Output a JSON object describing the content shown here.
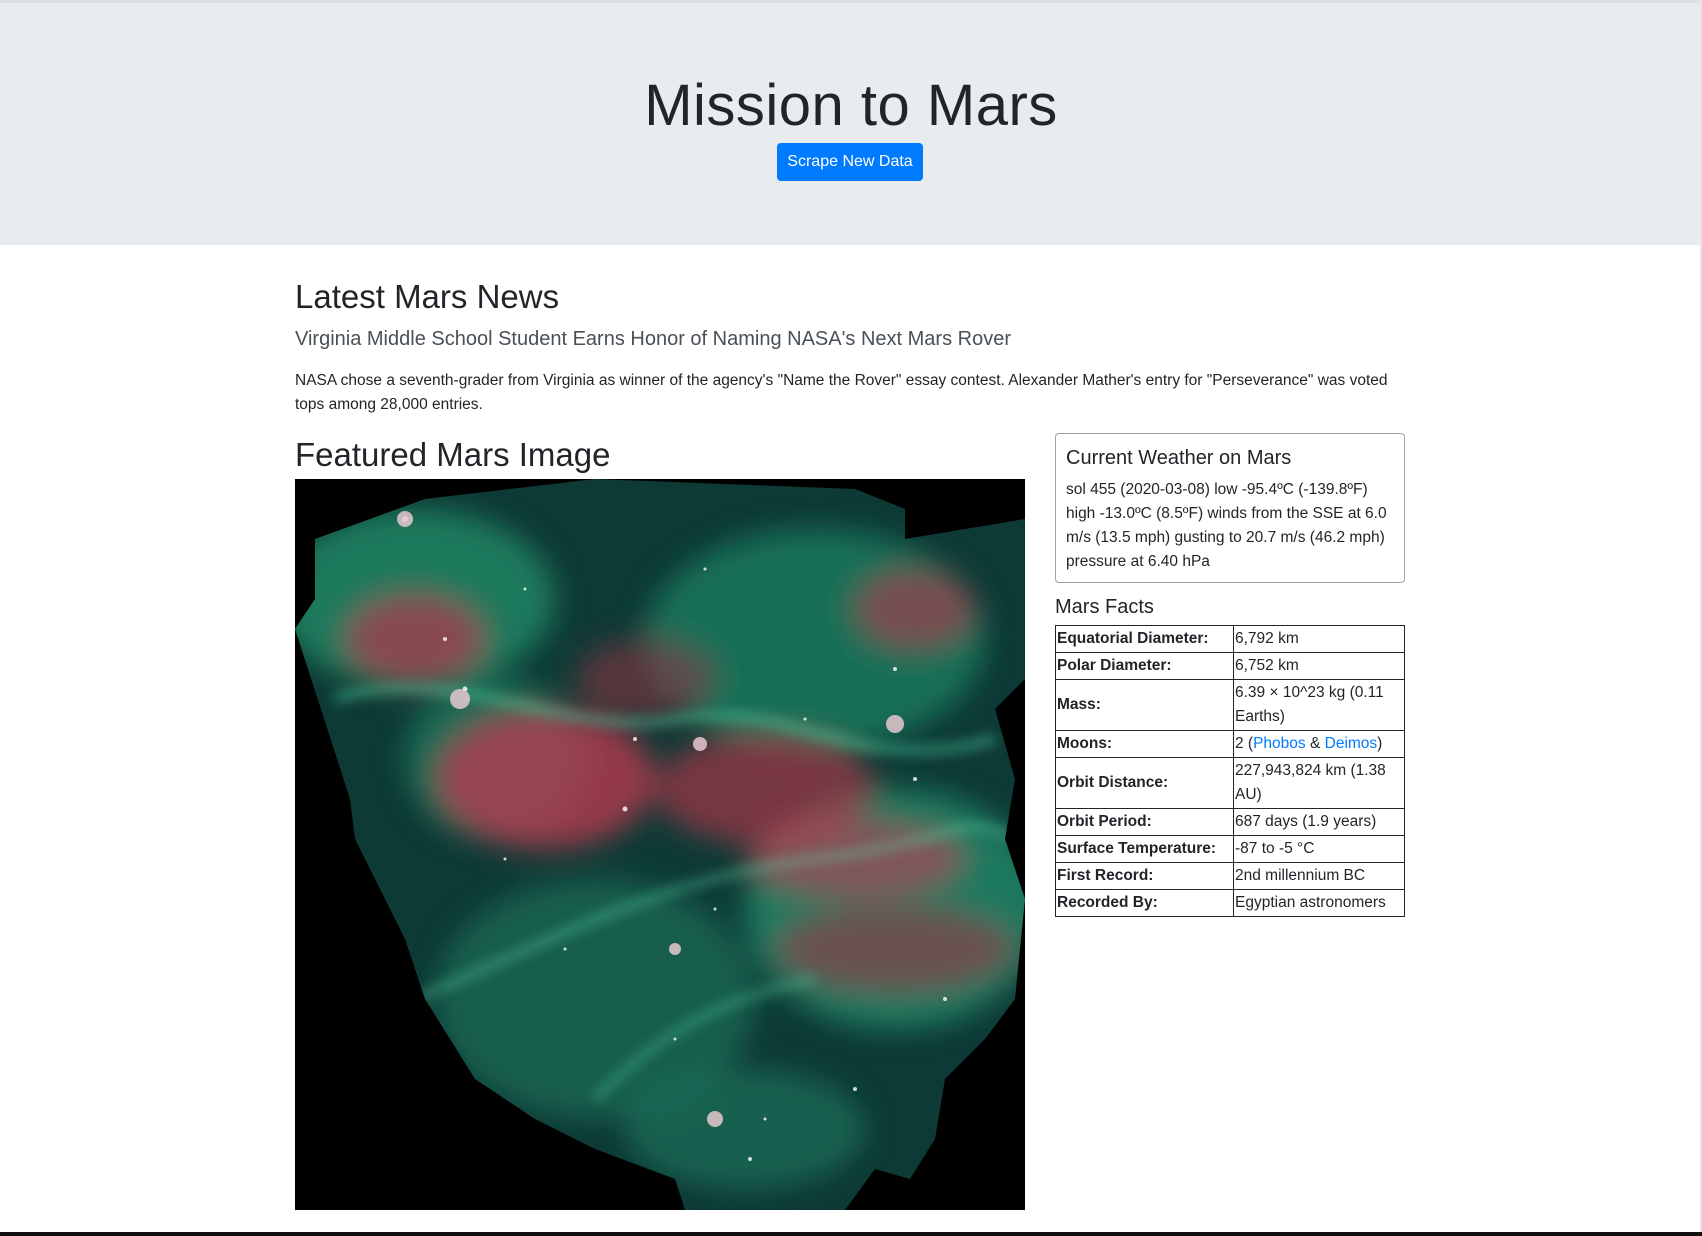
{
  "header": {
    "title": "Mission to Mars",
    "scrape_button": "Scrape New Data"
  },
  "news": {
    "heading": "Latest Mars News",
    "title": "Virginia Middle School Student Earns Honor of Naming NASA's Next Mars Rover",
    "paragraph": "NASA chose a seventh-grader from Virginia as winner of the agency's \"Name the Rover\" essay contest. Alexander Mather's entry for \"Perseverance\" was voted tops among 28,000 entries."
  },
  "featured_image": {
    "heading": "Featured Mars Image",
    "colors": {
      "background": "#000000",
      "nebula_green": "#1f8f6a",
      "nebula_red": "#c23a4f",
      "deep_teal": "#0f3d3a"
    }
  },
  "weather": {
    "heading": "Current Weather on Mars",
    "text": "sol 455 (2020-03-08) low -95.4ºC (-139.8ºF) high -13.0ºC (8.5ºF) winds from the SSE at 6.0 m/s (13.5 mph) gusting to 20.7 m/s (46.2 mph) pressure at 6.40 hPa"
  },
  "facts": {
    "heading": "Mars Facts",
    "rows": [
      {
        "key": "Equatorial Diameter:",
        "value": "6,792 km"
      },
      {
        "key": "Polar Diameter:",
        "value": "6,752 km"
      },
      {
        "key": "Mass:",
        "value": "6.39 × 10^23 kg (0.11 Earths)"
      },
      {
        "key": "Moons:",
        "value_prefix": "2 (",
        "link1": "Phobos",
        "sep": " & ",
        "link2": "Deimos",
        "value_suffix": ")"
      },
      {
        "key": "Orbit Distance:",
        "value": "227,943,824 km (1.38 AU)"
      },
      {
        "key": "Orbit Period:",
        "value": "687 days (1.9 years)"
      },
      {
        "key": "Surface Temperature:",
        "value": "-87 to -5 °C"
      },
      {
        "key": "First Record:",
        "value": "2nd millennium BC"
      },
      {
        "key": "Recorded By:",
        "value": "Egyptian astronomers"
      }
    ]
  },
  "colors": {
    "jumbotron_bg": "#e9ecef",
    "primary": "#007bff",
    "text": "#212529"
  }
}
